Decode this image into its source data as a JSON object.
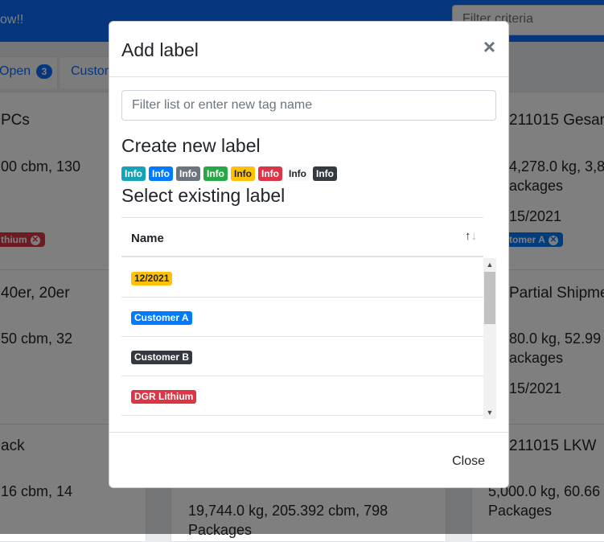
{
  "background": {
    "topbar_message": "ow!!",
    "filter_placeholder": "Filter criteria",
    "tabs": [
      {
        "label": "Open",
        "count": "3"
      },
      {
        "label": "Custom"
      }
    ],
    "left_col": {
      "card1_title": "PCs",
      "card1_line1": "00 cbm, 130",
      "card1_badge": "thium",
      "card2_title": "40er, 20er",
      "card2_line1": "50 cbm, 32",
      "card3_title": "ack",
      "card3_line1": "16 cbm, 14"
    },
    "middle_col": {
      "line1": "19,744.0 kg, 205.392 cbm, 798",
      "line2": "Packages"
    },
    "right_col": {
      "card1_title": "211015 Gesan",
      "card1_line1": "4,278.0 kg, 3,8",
      "card1_line2": "ackages",
      "card1_date": "15/2021",
      "card1_badge": "tomer A",
      "card2_title": "Partial Shipme",
      "card2_line1": "80.0 kg, 52.99",
      "card2_line2": "ackages",
      "card2_date": "15/2021",
      "card3_title": "211015 LKW",
      "card3_line1": "5,000.0 kg, 60.66",
      "card3_line2": "Packages"
    }
  },
  "modal": {
    "title": "Add label",
    "close_symbol": "×",
    "search_placeholder": "Filter list or enter new tag name",
    "create_heading": "Create new label",
    "new_chips": [
      {
        "label": "Info",
        "bg": "#17a2b8",
        "fg": "#ffffff"
      },
      {
        "label": "Info",
        "bg": "#007bff",
        "fg": "#ffffff"
      },
      {
        "label": "Info",
        "bg": "#6c757d",
        "fg": "#ffffff"
      },
      {
        "label": "Info",
        "bg": "#28a745",
        "fg": "#ffffff"
      },
      {
        "label": "Info",
        "bg": "#ffc107",
        "fg": "#212529"
      },
      {
        "label": "Info",
        "bg": "#dc3545",
        "fg": "#ffffff"
      },
      {
        "label": "Info",
        "bg": "#f8f9fa",
        "fg": "#212529"
      },
      {
        "label": "Info",
        "bg": "#343a40",
        "fg": "#ffffff"
      }
    ],
    "select_heading": "Select existing label",
    "table": {
      "column": "Name",
      "sort_icon": "sort-arrows-icon",
      "rows": [
        {
          "label": "12/2021",
          "bg": "#ffc107",
          "fg": "#212529"
        },
        {
          "label": "Customer A",
          "bg": "#007bff",
          "fg": "#ffffff"
        },
        {
          "label": "Customer B",
          "bg": "#343a40",
          "fg": "#ffffff"
        },
        {
          "label": "DGR Lithium",
          "bg": "#dc3545",
          "fg": "#ffffff"
        }
      ]
    },
    "footer_close": "Close"
  }
}
